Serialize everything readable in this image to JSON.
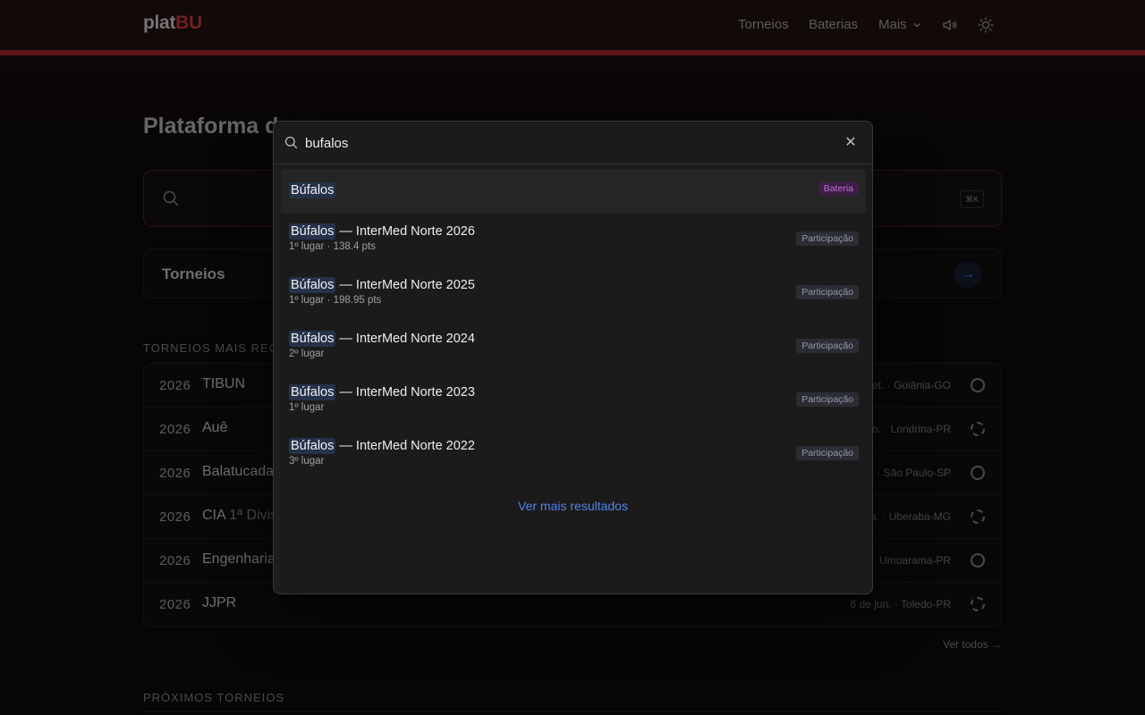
{
  "header": {
    "logo_part1": "plat",
    "logo_part2": "BU",
    "nav": [
      {
        "label": "Torneios"
      },
      {
        "label": "Baterias"
      },
      {
        "label": "Mais"
      }
    ]
  },
  "page": {
    "title_visible": "Plataforma d",
    "search_shortcut": "⌘K",
    "torneios_card_label": "Torneios",
    "recent_section_label": "TORNEIOS MAIS RECE",
    "upcoming_section_label": "PRÓXIMOS TORNEIOS",
    "see_all": "Ver todos →",
    "recent_rows": [
      {
        "year": "2026",
        "name": "TIBUN",
        "division": "",
        "meta": "et. · Goiânia-GO",
        "status": "solid"
      },
      {
        "year": "2026",
        "name": "Auê",
        "division": "",
        "meta": "o. · Londrina-PR",
        "status": "dashed"
      },
      {
        "year": "2026",
        "name": "Balatucada",
        "division": "",
        "meta": "o. · São Paulo-SP",
        "status": "solid"
      },
      {
        "year": "2026",
        "name": "CIA",
        "division": "1ª Divis",
        "meta": "a. · Uberaba-MG",
        "status": "dashed"
      },
      {
        "year": "2026",
        "name": "Engenharia",
        "division": "",
        "meta": "Umuarama-PR",
        "status": "solid"
      },
      {
        "year": "2026",
        "name": "JJPR",
        "division": "",
        "meta": "6 de jun. · Toledo-PR",
        "status": "dashed"
      }
    ]
  },
  "modal": {
    "query": "bufalos",
    "results": [
      {
        "highlight": "Búfalos",
        "rest": "",
        "sub": "",
        "badge": "Bateria",
        "badge_type": "bateria",
        "active": true
      },
      {
        "highlight": "Búfalos",
        "rest": " — InterMed Norte 2026",
        "sub": "1º lugar · 138.4 pts",
        "badge": "Participação",
        "badge_type": "part",
        "active": false
      },
      {
        "highlight": "Búfalos",
        "rest": " — InterMed Norte 2025",
        "sub": "1º lugar · 198.95 pts",
        "badge": "Participação",
        "badge_type": "part",
        "active": false
      },
      {
        "highlight": "Búfalos",
        "rest": " — InterMed Norte 2024",
        "sub": "2º lugar",
        "badge": "Participação",
        "badge_type": "part",
        "active": false
      },
      {
        "highlight": "Búfalos",
        "rest": " — InterMed Norte 2023",
        "sub": "1º lugar",
        "badge": "Participação",
        "badge_type": "part",
        "active": false
      },
      {
        "highlight": "Búfalos",
        "rest": " — InterMed Norte 2022",
        "sub": "3º lugar",
        "badge": "Participação",
        "badge_type": "part",
        "active": false
      }
    ],
    "more_results": "Ver mais resultados"
  },
  "colors": {
    "brand_red": "#d23a3c",
    "header_bg": "#211112",
    "accent_blue": "#4d84ea",
    "badge_bateria": "#c36bd6",
    "badge_participacao": "#9297a8"
  },
  "icons": [
    "search-icon",
    "close-icon",
    "chevron-down-icon",
    "speaker-icon",
    "sun-icon",
    "arrow-right-icon"
  ]
}
